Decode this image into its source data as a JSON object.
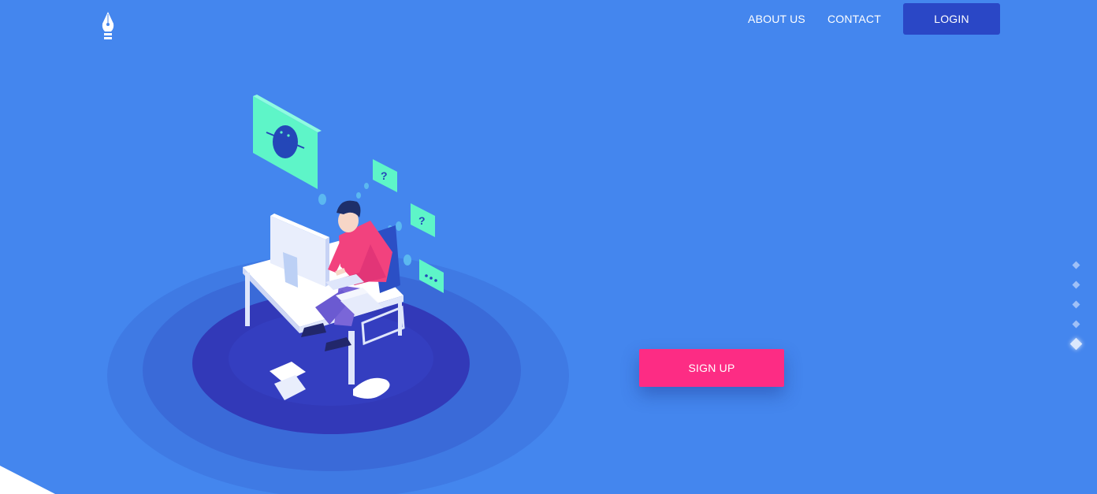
{
  "header": {
    "logo_icon": "fountain-pen-nib-icon",
    "nav": [
      {
        "label": "ABOUT US"
      },
      {
        "label": "CONTACT"
      }
    ],
    "login_label": "LOGIN"
  },
  "hero": {
    "illustration": "isometric-person-at-desk-illustration",
    "signup_label": "SIGN UP"
  },
  "slider": {
    "dot_count": 5,
    "active_index": 4
  },
  "colors": {
    "background": "#4486ee",
    "login_button": "#2a47c6",
    "signup_button": "#fd2c84",
    "accent_mint": "#5ef5c8"
  }
}
